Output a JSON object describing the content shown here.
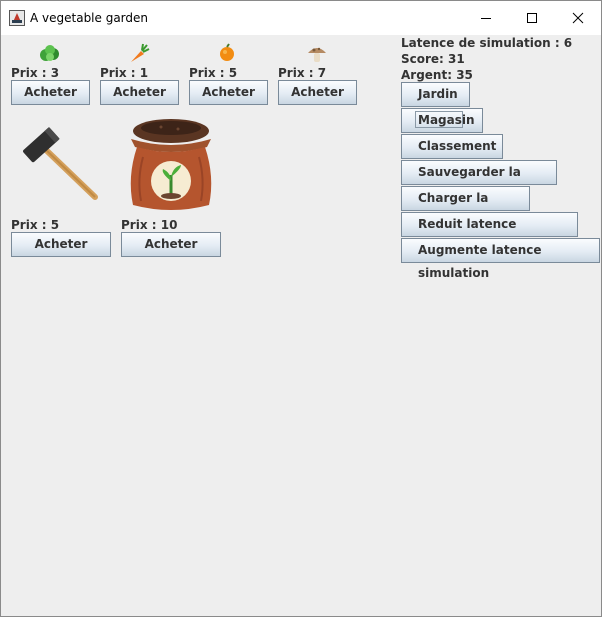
{
  "window": {
    "title": "A vegetable garden"
  },
  "shop": {
    "row1": [
      {
        "icon": "lettuce-icon",
        "price": "Prix : 3",
        "button": "Acheter"
      },
      {
        "icon": "carrot-icon",
        "price": "Prix : 1",
        "button": "Acheter"
      },
      {
        "icon": "orange-icon",
        "price": "Prix : 5",
        "button": "Acheter"
      },
      {
        "icon": "mushroom-icon",
        "price": "Prix : 7",
        "button": "Acheter"
      }
    ],
    "row2": [
      {
        "icon": "hammer-icon",
        "price": "Prix : 5",
        "button": "Acheter"
      },
      {
        "icon": "seed-bag-icon",
        "price": "Prix : 10",
        "button": "Acheter"
      }
    ]
  },
  "stats": {
    "latency": "Latence de simulation : 6",
    "score": "Score: 31",
    "money": "Argent: 35"
  },
  "menu": [
    "Jardin",
    "Magasin",
    "Classement",
    "Sauvegarder la partie",
    "Charger la partie",
    "Reduit latence simulation",
    "Augmente latence simulation"
  ],
  "colors": {
    "window_bg": "#eeeeee",
    "titlebar_bg": "#ffffff",
    "button_border": "#7a8a99",
    "text": "#333333"
  }
}
